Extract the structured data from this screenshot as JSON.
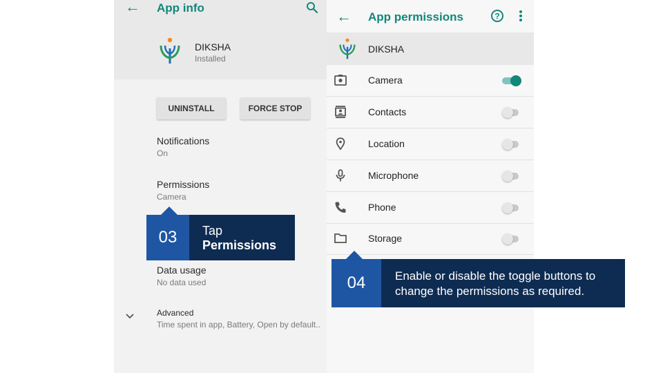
{
  "app_info": {
    "title": "App info",
    "app": {
      "name": "DIKSHA",
      "status": "Installed"
    },
    "buttons": {
      "uninstall": "UNINSTALL",
      "force_stop": "FORCE STOP"
    },
    "items": [
      {
        "title": "Notifications",
        "subtitle": "On"
      },
      {
        "title": "Permissions",
        "subtitle": "Camera"
      },
      {
        "title": "Data usage",
        "subtitle": "No data used"
      },
      {
        "title": "Advanced",
        "subtitle": "Time spent in app, Battery, Open by default.."
      }
    ]
  },
  "permissions": {
    "title": "App permissions",
    "app_name": "DIKSHA",
    "rows": [
      {
        "label": "Camera",
        "icon": "camera-icon",
        "enabled": true
      },
      {
        "label": "Contacts",
        "icon": "contacts-icon",
        "enabled": false
      },
      {
        "label": "Location",
        "icon": "location-icon",
        "enabled": false
      },
      {
        "label": "Microphone",
        "icon": "microphone-icon",
        "enabled": false
      },
      {
        "label": "Phone",
        "icon": "phone-icon",
        "enabled": false
      },
      {
        "label": "Storage",
        "icon": "folder-icon",
        "enabled": false
      }
    ]
  },
  "callouts": {
    "step3": {
      "number": "03",
      "line1": "Tap",
      "line2": "Permissions"
    },
    "step4": {
      "number": "04",
      "text": "Enable or disable the toggle buttons to change the permissions as required."
    }
  },
  "colors": {
    "accent": "#12877a",
    "callout_number_bg": "#1f56a3",
    "callout_text_bg": "#0e2c52"
  }
}
